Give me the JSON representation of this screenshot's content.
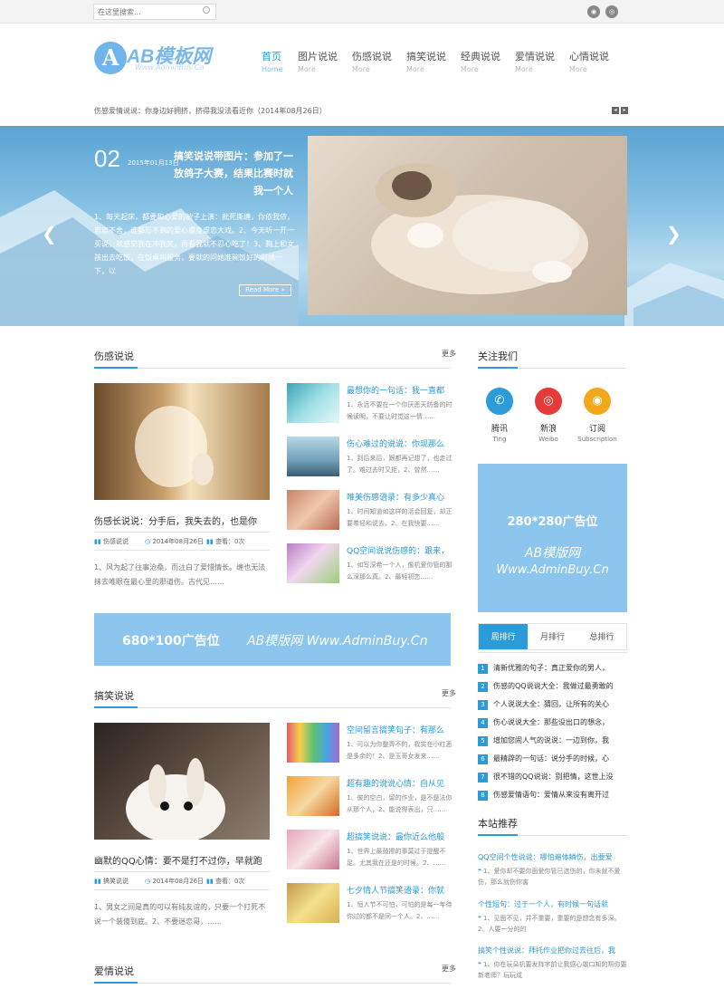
{
  "topbar": {
    "search_placeholder": "在这里搜索..."
  },
  "logo": {
    "letter": "A",
    "title": "AB模板网",
    "sub": "Www.AdminBuy.Cn"
  },
  "nav": [
    {
      "label": "首页",
      "sub": "Home"
    },
    {
      "label": "图片说说",
      "sub": "More"
    },
    {
      "label": "伤感说说",
      "sub": "More"
    },
    {
      "label": "搞笑说说",
      "sub": "More"
    },
    {
      "label": "经典说说",
      "sub": "More"
    },
    {
      "label": "爱情说说",
      "sub": "More"
    },
    {
      "label": "心情说说",
      "sub": "More"
    }
  ],
  "ticker": "伤感爱情说说：你身边好拥挤，挤得我没法看近你（2014年08月26日）",
  "slide": {
    "num": "02",
    "date": "2015年01月13日",
    "title": "搞笑说说带图片：参加了一放鸽子大赛，结果比赛时就我一个人",
    "desc": "1、每天起床，都要和心爱的被子上演：批死撕缠，你依我依，恋恋不舍，谁都形不到的爱心虐身虐恋大戏。2、今天听一开一买说，就感觉我在冲我笑，再看我就不忍心吃了！3、胸上和女孩出去吃饭，在饭桌叫服务，要就的问她准碗饭好的阿姨一下，以",
    "read_more": "Read More »"
  },
  "sections": {
    "sad": {
      "title": "伤感说说",
      "more": "更多",
      "big_title": "伤感长说说：分手后，我失去的，也是你",
      "cat": "伤感说说",
      "date": "2014年08月26日",
      "views": "查看：0次",
      "excerpt": "1、风为起了往事沧桑，而注白了爱惜情长。缠也无法抹去唯眼在最心里的那道伤。古代见……",
      "items": [
        {
          "title": "最想你的一句话：我一直都",
          "desc": "1、永远不要在一个你厌恶天防备的时候读明，不要让时觉这一情……"
        },
        {
          "title": "伤心难过的说说：你现那么",
          "desc": "1、到后来后，跟都再记想了，也走过了。难过去时又拒，2、曾然……"
        },
        {
          "title": "唯美伤感语录：有多少真心",
          "desc": "1、时间知道如这样的活会回复，却正要希轻和说去。2、在我快要……"
        },
        {
          "title": "QQ空间说说伤感的：跟来，",
          "desc": "1、如写深希一个人，像机爱你管的那么深那么真。2、最轻初恋……"
        }
      ]
    },
    "funny": {
      "title": "搞笑说说",
      "more": "更多",
      "big_title": "幽默的QQ心情：要不是打不过你，早就跑",
      "cat": "搞笑说说",
      "date": "2014年08月26日",
      "views": "查看：0次",
      "excerpt": "1、男女之间是真的可以有纯友谊的，只要一个打死不说一个装傻到底。2、不要迷恋哥，……",
      "items": [
        {
          "title": "空间留言搞笑句子：有那么",
          "desc": "1、可以为你整弄不的，我实在小红恶是多余的！2、是玉哥女发来……"
        },
        {
          "title": "超有趣的说说心情：自从见",
          "desc": "1、彼的空白，留的作业，是不是法你从那个人，2、能说得表出，只……"
        },
        {
          "title": "超搞笑说说：最你近么他般",
          "desc": "1、世界上最鼓擦的事莫过于提醒不足。尤其我在还是的时候。2、……"
        },
        {
          "title": "七夕情人节搞笑语录：你就",
          "desc": "1、恒人节不可怕，可怕的是每一年待你过的都不是同一个人。2、……"
        }
      ]
    },
    "love": {
      "title": "爱情说说",
      "more": "更多"
    }
  },
  "ads": {
    "wide_text": "680*100广告位",
    "wide_brand": "AB模版网   Www.AdminBuy.Cn",
    "side_text": "280*280广告位",
    "side_brand": "AB模版网",
    "side_url": "Www.AdminBuy.Cn"
  },
  "follow": {
    "title": "关注我们",
    "items": [
      {
        "name": "腾讯",
        "sub": "Ting",
        "color": "#2b9bd9",
        "icon": "tencent-weibo-icon"
      },
      {
        "name": "新浪",
        "sub": "Weibo",
        "color": "#e43a3a",
        "icon": "sina-weibo-icon"
      },
      {
        "name": "订阅",
        "sub": "Subscription",
        "color": "#f3a71a",
        "icon": "rss-icon"
      }
    ]
  },
  "rank_tabs": [
    "周排行",
    "月排行",
    "总排行"
  ],
  "rank": [
    "清新优雅的句子：真正爱你的男人，",
    "伤感的QQ说说大全：我做过最勇敢的",
    "个人说说大全：猜回，让所有的关心",
    "伤心说说大全：那些没出口的想念，",
    "增加您闹人气的说说：一边到你，我",
    "最精辟的一句话：说分手的时候，心",
    "很不错的QQ说说：别把情，这世上没",
    "伤感爱情语句：爱情从来没有离开过"
  ],
  "recommend": {
    "title": "本站推荐",
    "items": [
      {
        "title": "QQ空间个性说说：哪怕遍体鳞伤，出要爱",
        "desc": "1、爱你却不要你面爱你管已选伤的，你未就不爱伤，那么就伤你害"
      },
      {
        "title": "个性短句：过于一个人，有时候一句话就",
        "desc": "1、见面不见，并不重要，重要的是想念有多深。2、人要一分的的"
      },
      {
        "title": "搞笑个性说说：拜托作业把你过去往后，我",
        "desc": "1、你在玩朵机要发阵字前让我感心敢口知的帮你要新老师？玩玩成"
      }
    ]
  },
  "colors": {
    "accent": "#2b9bd9",
    "ad": "#8cc6ee"
  }
}
